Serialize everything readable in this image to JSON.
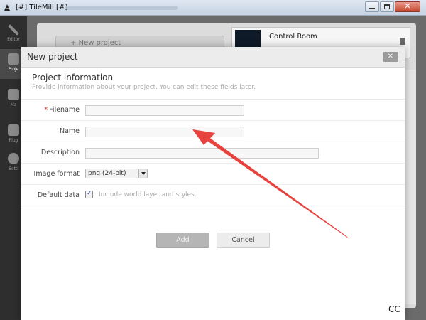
{
  "window": {
    "title": "[#] TileMill [#]",
    "controls": {
      "close_glyph": "✕"
    }
  },
  "sidebar": {
    "items": [
      {
        "label": "Editor",
        "icon": "pencil-icon",
        "active": false
      },
      {
        "label": "Proje",
        "icon": "folder-icon",
        "active": true
      },
      {
        "label": "Ma",
        "icon": "layers-icon",
        "active": false
      },
      {
        "label": "Plug",
        "icon": "plugin-icon",
        "active": false
      },
      {
        "label": "Setti",
        "icon": "gear-icon",
        "active": false
      }
    ]
  },
  "background": {
    "new_project_button": "+ New project",
    "project_card_title": "Control Room"
  },
  "modal": {
    "title": "New project",
    "close_label": "✕",
    "section_title": "Project information",
    "section_description": "Provide information about your project. You can edit these fields later.",
    "fields": {
      "filename": {
        "required_mark": "*",
        "label": "Filename",
        "value": ""
      },
      "name": {
        "label": "Name",
        "value": ""
      },
      "description": {
        "label": "Description",
        "value": ""
      },
      "image_format": {
        "label": "Image format",
        "selected": "png (24-bit)"
      },
      "default_data": {
        "label": "Default data",
        "checked": true,
        "text": "Include world layer and styles."
      }
    },
    "buttons": {
      "add": "Add",
      "cancel": "Cancel"
    }
  },
  "annotation": {
    "color": "#e8423f"
  },
  "watermark": "CC"
}
